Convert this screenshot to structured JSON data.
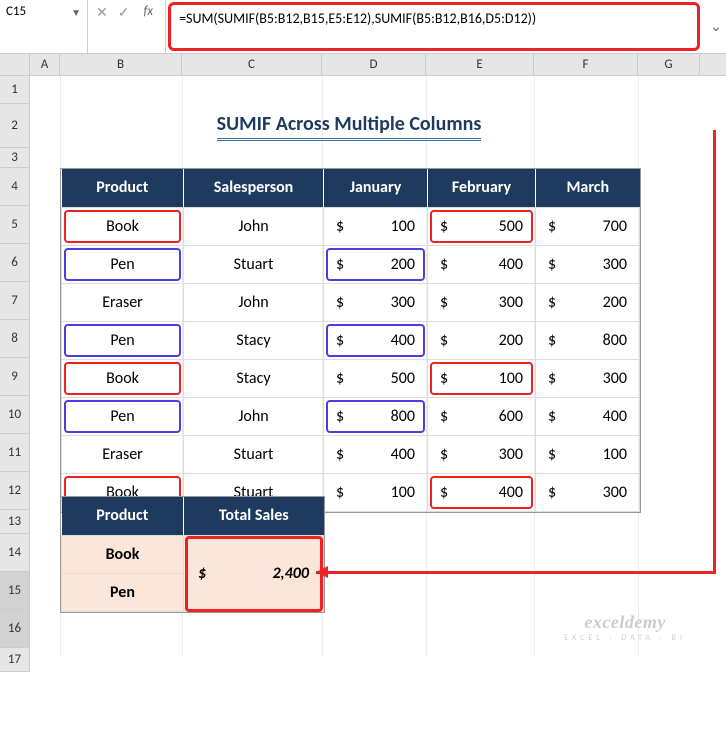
{
  "name_box": "C15",
  "formula": "=SUM(SUMIF(B5:B12,B15,E5:E12),SUMIF(B5:B12,B16,D5:D12))",
  "columns": [
    "A",
    "B",
    "C",
    "D",
    "E",
    "F",
    "G"
  ],
  "rows": [
    "1",
    "2",
    "3",
    "4",
    "5",
    "6",
    "7",
    "8",
    "9",
    "10",
    "11",
    "12",
    "13",
    "14",
    "15",
    "16",
    "17"
  ],
  "title": "SUMIF Across Multiple Columns",
  "headers": {
    "product": "Product",
    "salesperson": "Salesperson",
    "jan": "January",
    "feb": "February",
    "mar": "March"
  },
  "data": [
    {
      "product": "Book",
      "sp": "John",
      "jan": 100,
      "feb": 500,
      "mar": 700,
      "hlP": "red",
      "hlE": "red"
    },
    {
      "product": "Pen",
      "sp": "Stuart",
      "jan": 200,
      "feb": 400,
      "mar": 300,
      "hlP": "blue",
      "hlD": "blue"
    },
    {
      "product": "Eraser",
      "sp": "John",
      "jan": 300,
      "feb": 300,
      "mar": 200
    },
    {
      "product": "Pen",
      "sp": "Stacy",
      "jan": 400,
      "feb": 200,
      "mar": 800,
      "hlP": "blue",
      "hlD": "blue"
    },
    {
      "product": "Book",
      "sp": "Stacy",
      "jan": 500,
      "feb": 100,
      "mar": 300,
      "hlP": "red",
      "hlE": "red"
    },
    {
      "product": "Pen",
      "sp": "John",
      "jan": 800,
      "feb": 600,
      "mar": 400,
      "hlP": "blue",
      "hlD": "blue"
    },
    {
      "product": "Eraser",
      "sp": "Stuart",
      "jan": 400,
      "feb": 300,
      "mar": 100
    },
    {
      "product": "Book",
      "sp": "Stuart",
      "jan": 100,
      "feb": 400,
      "mar": 300,
      "hlP": "red",
      "hlE": "red"
    }
  ],
  "summary": {
    "h_product": "Product",
    "h_total": "Total Sales",
    "r1": "Book",
    "r2": "Pen",
    "total_sym": "$",
    "total_val": "2,400"
  },
  "watermark": {
    "line1": "exceldemy",
    "line2": "EXCEL · DATA · BI"
  },
  "currency": "$"
}
